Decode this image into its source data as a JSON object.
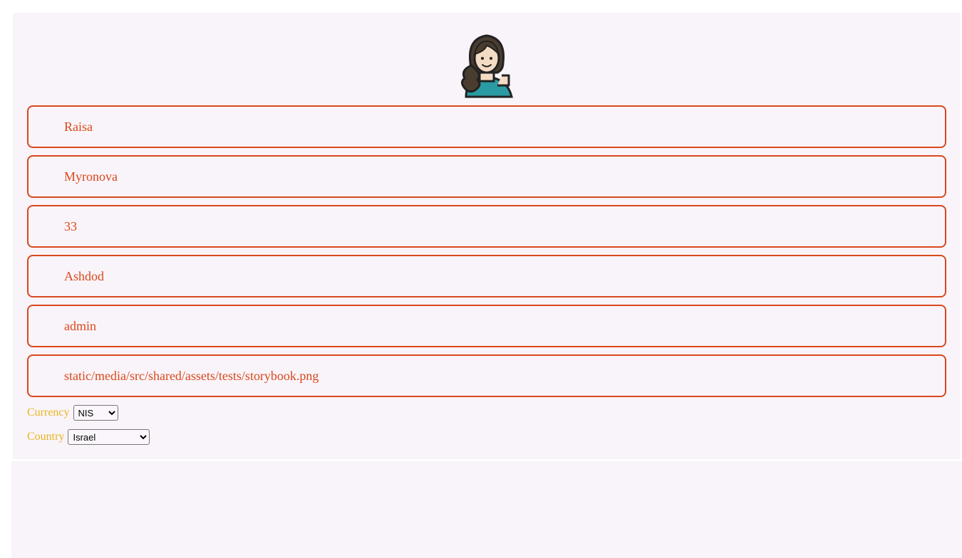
{
  "profile": {
    "avatar_icon": "user-avatar-icon",
    "fields": [
      {
        "id": "first-name",
        "value": "Raisa"
      },
      {
        "id": "last-name",
        "value": "Myronova"
      },
      {
        "id": "age",
        "value": "33"
      },
      {
        "id": "city",
        "value": "Ashdod"
      },
      {
        "id": "role",
        "value": "admin"
      },
      {
        "id": "image-path",
        "value": "static/media/src/shared/assets/tests/storybook.png"
      }
    ],
    "currency": {
      "label": "Currency",
      "value": "NIS"
    },
    "country": {
      "label": "Country",
      "value": "Israel"
    }
  },
  "colors": {
    "accent": "#d9481c",
    "label": "#e8b420",
    "card_bg": "#f9f4f9"
  }
}
